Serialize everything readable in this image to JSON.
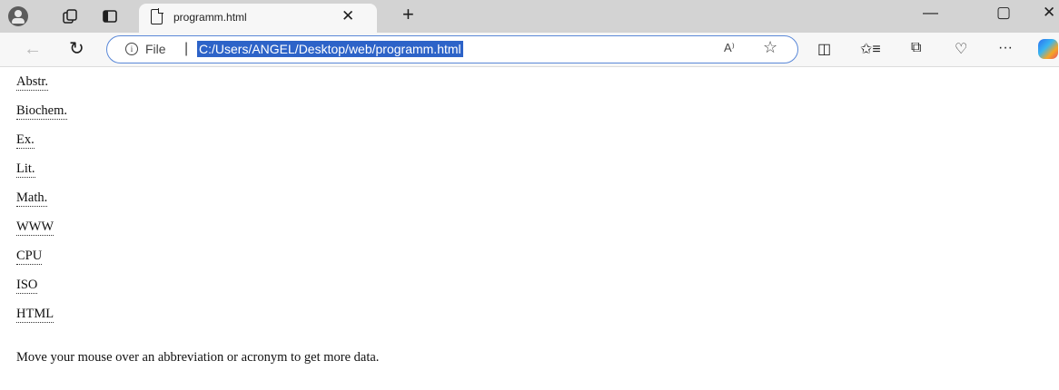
{
  "browser": {
    "tab": {
      "title": "programm.html",
      "close_glyph": "✕"
    },
    "new_tab_glyph": "+",
    "window_controls": {
      "minimize": "—",
      "maximize": "▢",
      "close": "✕"
    },
    "address_bar": {
      "scheme_label": "File",
      "separator": "|",
      "url": "C:/Users/ANGEL/Desktop/web/programm.html"
    },
    "icons": {
      "workspaces": "workspaces-icon",
      "tab_actions": "tab-actions-icon",
      "back": "back-arrow-icon",
      "reload": "reload-icon",
      "info": "info-icon",
      "read_aloud": "read-aloud-icon",
      "favorite": "star-icon",
      "split_screen": "split-screen-icon",
      "favorites": "favorites-icon",
      "collections": "collections-icon",
      "browser_essentials": "heart-pulse-icon",
      "more": "more-icon",
      "copilot": "copilot-icon"
    },
    "glyphs": {
      "back": "←",
      "reload": "↻",
      "info": "i",
      "read_aloud": "A⁾",
      "favorite": "☆",
      "split": "◫",
      "favorites": "✩≡",
      "collections": "⧉",
      "essentials": "♡",
      "more": "···"
    },
    "colors": {
      "accent": "#2d63c8",
      "tabstrip": "#d3d3d3",
      "toolbar": "#f7f7f7"
    }
  },
  "page": {
    "abbreviations": [
      "Abstr.",
      "Biochem.",
      "Ex.",
      "Lit.",
      "Math.",
      "WWW",
      "CPU",
      "ISO",
      "HTML"
    ],
    "note": "Move your mouse over an abbreviation or acronym to get more data."
  }
}
